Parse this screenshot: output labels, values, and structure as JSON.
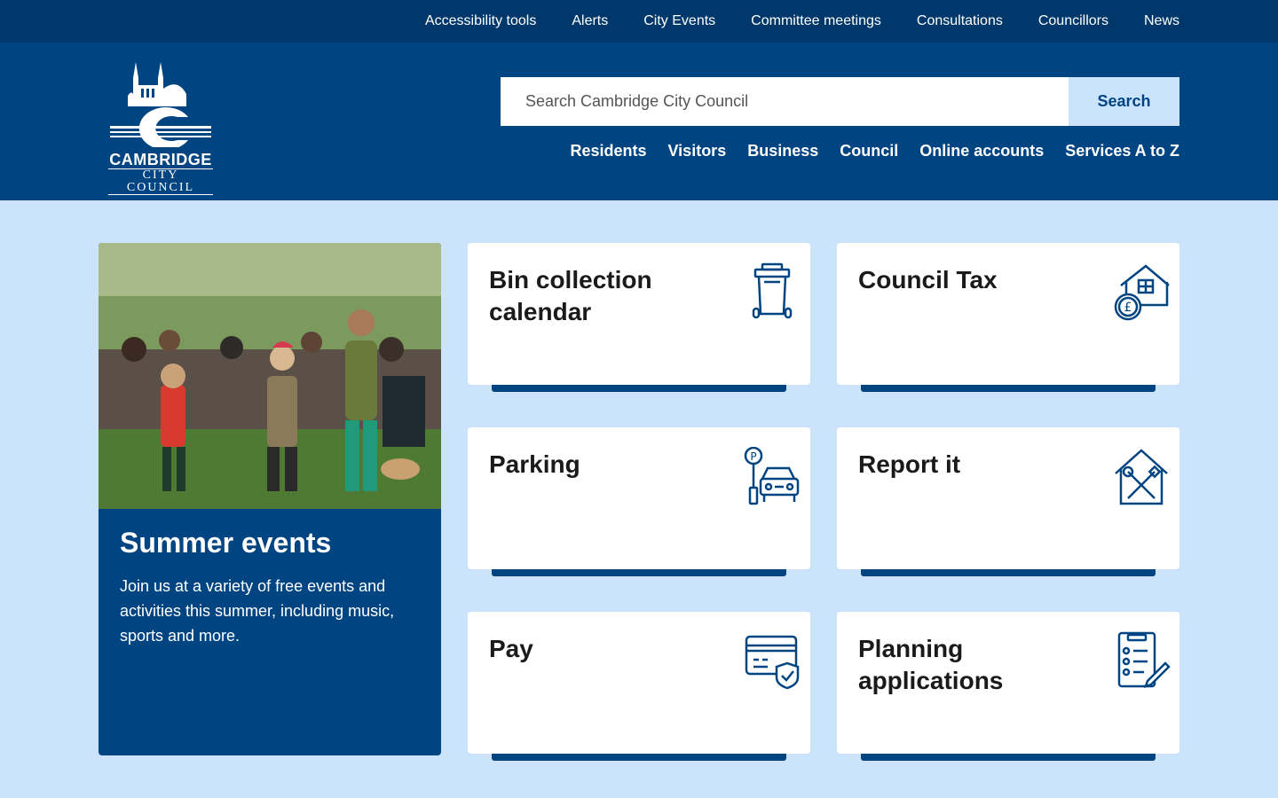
{
  "utility_links": [
    "Accessibility tools",
    "Alerts",
    "City Events",
    "Committee meetings",
    "Consultations",
    "Councillors",
    "News"
  ],
  "logo": {
    "line1": "CAMBRIDGE",
    "line2": "CITY COUNCIL"
  },
  "search": {
    "placeholder": "Search Cambridge City Council",
    "button_label": "Search"
  },
  "main_nav": [
    "Residents",
    "Visitors",
    "Business",
    "Council",
    "Online accounts",
    "Services A to Z"
  ],
  "feature": {
    "title": "Summer events",
    "description": "Join us at a variety of free events and activities this summer, including music, sports and more."
  },
  "cards": [
    {
      "title": "Bin collection calendar",
      "icon": "bin-icon"
    },
    {
      "title": "Council Tax",
      "icon": "council-tax-icon"
    },
    {
      "title": "Parking",
      "icon": "parking-icon"
    },
    {
      "title": "Report it",
      "icon": "report-it-icon"
    },
    {
      "title": "Pay",
      "icon": "payment-card-icon"
    },
    {
      "title": "Planning applications",
      "icon": "planning-checklist-icon"
    }
  ],
  "colors": {
    "primary": "#004481",
    "utility_bar": "#00386b",
    "page_bg": "#cce3fc",
    "card_bg": "#ffffff"
  }
}
